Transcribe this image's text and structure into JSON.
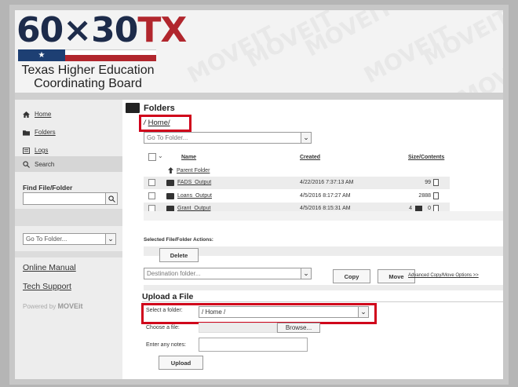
{
  "logo": {
    "number": "60×30",
    "suffix": "TX",
    "line1": "Texas Higher Education",
    "line2": "Coordinating Board",
    "star": "★"
  },
  "watermark": "MOVEIT",
  "sidebar": {
    "items": [
      {
        "label": "Home",
        "icon": "home-icon"
      },
      {
        "label": "Folders",
        "icon": "folder-icon"
      },
      {
        "label": "Logs",
        "icon": "logs-icon"
      }
    ],
    "search_label": "Search",
    "find_label": "Find File/Folder",
    "find_value": "",
    "goto_placeholder": "Go To Folder...",
    "online_manual": "Online Manual",
    "tech_support": "Tech Support",
    "powered_by": "Powered by",
    "powered_brand": "MOVEit"
  },
  "main": {
    "title": "Folders",
    "breadcrumb_slash": "/",
    "breadcrumb": "Home/",
    "goto_placeholder": "Go To Folder...",
    "columns": {
      "name": "Name",
      "created": "Created",
      "size": "Size/Contents"
    },
    "parent_folder": "Parent Folder",
    "rows": [
      {
        "name": "FADS_Output",
        "created": "4/22/2016 7:37:13 AM",
        "size": "99"
      },
      {
        "name": "Loans_Output",
        "created": "4/5/2016 8:17:27 AM",
        "size": "2888"
      },
      {
        "name": "Grant_Output",
        "created": "4/5/2016 8:15:31 AM",
        "size_a": "4",
        "size_b": "0"
      }
    ],
    "actions_label": "Selected File/Folder Actions:",
    "delete_label": "Delete",
    "destination_placeholder": "Destination folder...",
    "copy_label": "Copy",
    "move_label": "Move",
    "advanced_link": "Advanced Copy/Move Options >>"
  },
  "upload": {
    "title": "Upload a File",
    "select_folder_label": "Select a folder:",
    "select_folder_value": "/ Home /",
    "choose_file_label": "Choose a file:",
    "browse_label": "Browse...",
    "notes_label": "Enter any notes:",
    "notes_value": "",
    "upload_label": "Upload"
  },
  "colors": {
    "highlight": "#d0021b",
    "brand_navy": "#1d2b4a",
    "brand_red": "#b1262d"
  }
}
